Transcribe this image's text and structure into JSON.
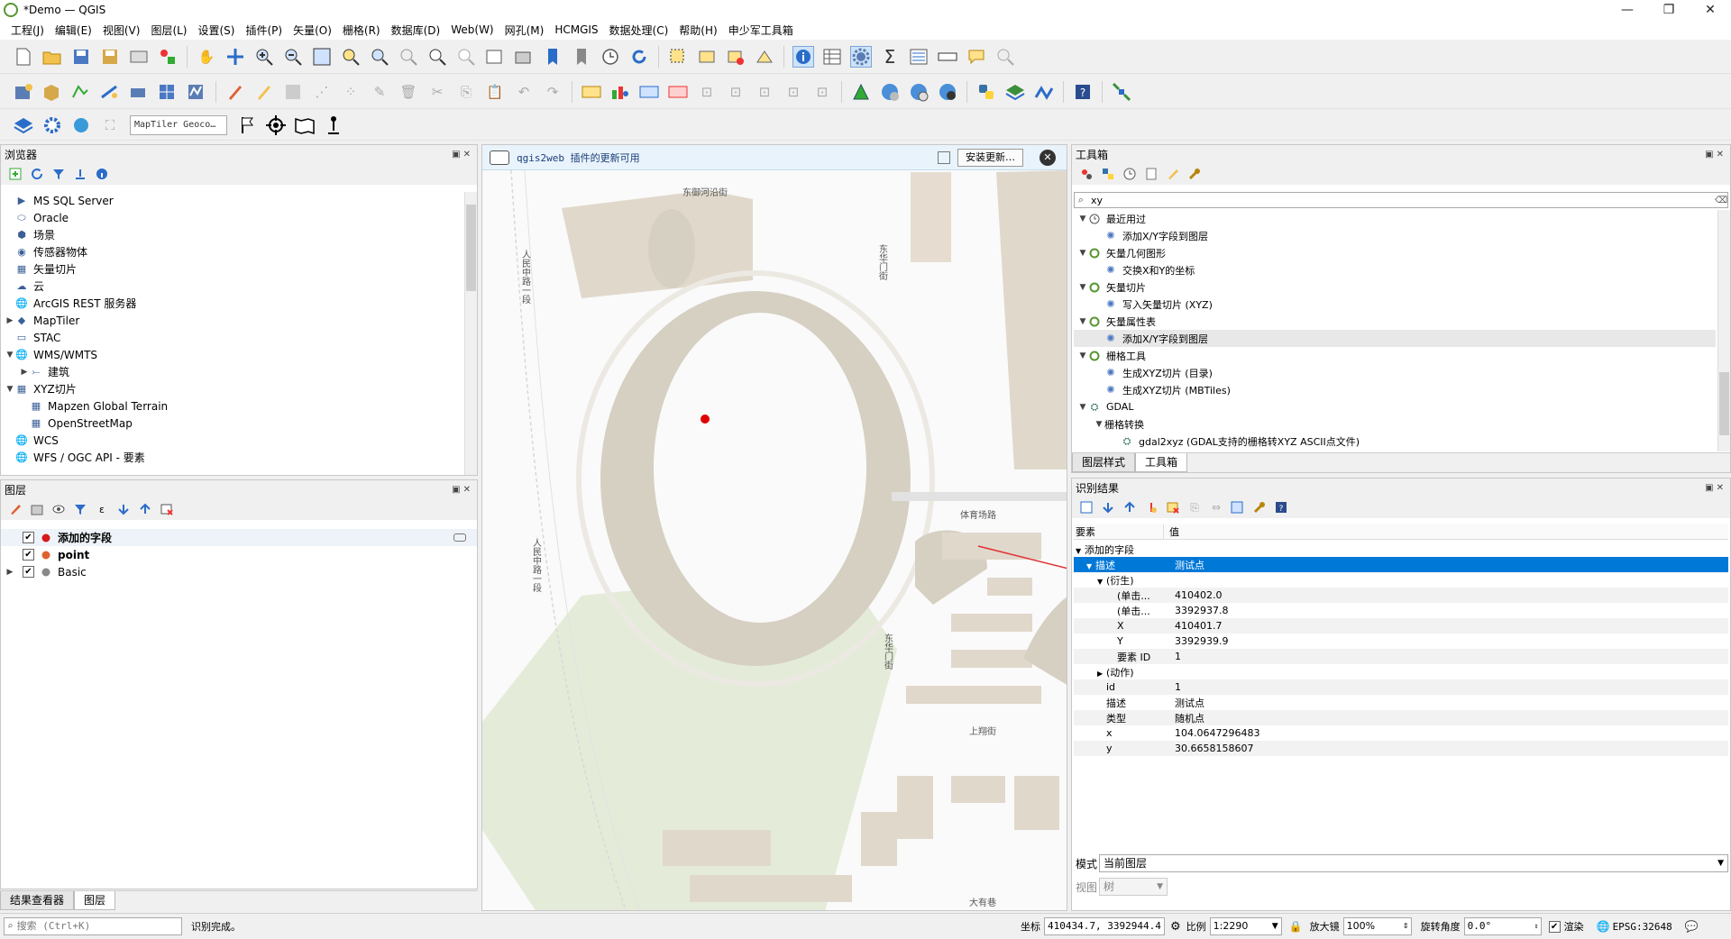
{
  "window": {
    "title": "*Demo — QGIS",
    "minimize": "—",
    "maximize": "❐",
    "close": "✕"
  },
  "menubar": [
    "工程(J)",
    "编辑(E)",
    "视图(V)",
    "图层(L)",
    "设置(S)",
    "插件(P)",
    "矢量(O)",
    "栅格(R)",
    "数据库(D)",
    "Web(W)",
    "网孔(M)",
    "HCMGIS",
    "数据处理(C)",
    "帮助(H)",
    "申少军工具箱"
  ],
  "geocoder": {
    "placeholder": "MapTiler Geoco…"
  },
  "browser": {
    "title": "浏览器",
    "items": [
      {
        "label": "MS SQL Server",
        "icon": "mssql-icon",
        "indent": 0,
        "arrow": ""
      },
      {
        "label": "Oracle",
        "icon": "oracle-icon",
        "indent": 0,
        "arrow": ""
      },
      {
        "label": "场景",
        "icon": "scene-icon",
        "indent": 0,
        "arrow": ""
      },
      {
        "label": "传感器物体",
        "icon": "sensor-icon",
        "indent": 0,
        "arrow": ""
      },
      {
        "label": "矢量切片",
        "icon": "vector-tile-icon",
        "indent": 0,
        "arrow": ""
      },
      {
        "label": "云",
        "icon": "cloud-icon",
        "indent": 0,
        "arrow": ""
      },
      {
        "label": "ArcGIS REST 服务器",
        "icon": "arcgis-icon",
        "indent": 0,
        "arrow": ""
      },
      {
        "label": "MapTiler",
        "icon": "maptiler-icon",
        "indent": 0,
        "arrow": "▶"
      },
      {
        "label": "STAC",
        "icon": "stac-icon",
        "indent": 0,
        "arrow": ""
      },
      {
        "label": "WMS/WMTS",
        "icon": "wms-icon",
        "indent": 0,
        "arrow": "▼"
      },
      {
        "label": "建筑",
        "icon": "wms-layer-icon",
        "indent": 1,
        "arrow": "▶"
      },
      {
        "label": "XYZ切片",
        "icon": "xyz-icon",
        "indent": 0,
        "arrow": "▼"
      },
      {
        "label": "Mapzen Global Terrain",
        "icon": "xyz-layer-icon",
        "indent": 1,
        "arrow": ""
      },
      {
        "label": "OpenStreetMap",
        "icon": "xyz-layer-icon",
        "indent": 1,
        "arrow": ""
      },
      {
        "label": "WCS",
        "icon": "wcs-icon",
        "indent": 0,
        "arrow": ""
      },
      {
        "label": "WFS / OGC API - 要素",
        "icon": "wfs-icon",
        "indent": 0,
        "arrow": ""
      }
    ]
  },
  "layers": {
    "title": "图层",
    "items": [
      {
        "label": "添加的字段",
        "checked": "✔",
        "arrow": "",
        "bold": true,
        "color": "#d7191c"
      },
      {
        "label": "point",
        "checked": "✔",
        "arrow": "",
        "bold": true,
        "color": "#e06030"
      },
      {
        "label": "Basic",
        "checked": "✔",
        "arrow": "▶",
        "bold": false,
        "color": "#888888"
      }
    ]
  },
  "bottomTabs": [
    "结果查看器",
    "图层"
  ],
  "notification": {
    "text": "qgis2web 插件的更新可用",
    "button": "安装更新…"
  },
  "map": {
    "labels": [
      "东御河沿街",
      "人民中路一段",
      "东华门街",
      "体育场路",
      "人民中路一段",
      "东华门街",
      "上翔街",
      "大有巷"
    ]
  },
  "toolbox": {
    "title": "工具箱",
    "search": "xy",
    "items": [
      {
        "label": "最近用过",
        "arrow": "▼",
        "indent": 0,
        "icon": "clock-icon"
      },
      {
        "label": "添加X/Y字段到图层",
        "arrow": "",
        "indent": 1,
        "icon": "gear-icon"
      },
      {
        "label": "矢量几何图形",
        "arrow": "▼",
        "indent": 0,
        "icon": "qgis-icon"
      },
      {
        "label": "交换X和Y的坐标",
        "arrow": "",
        "indent": 1,
        "icon": "gear-icon"
      },
      {
        "label": "矢量切片",
        "arrow": "▼",
        "indent": 0,
        "icon": "qgis-icon"
      },
      {
        "label": "写入矢量切片 (XYZ)",
        "arrow": "",
        "indent": 1,
        "icon": "gear-icon"
      },
      {
        "label": "矢量属性表",
        "arrow": "▼",
        "indent": 0,
        "icon": "qgis-icon"
      },
      {
        "label": "添加X/Y字段到图层",
        "arrow": "",
        "indent": 1,
        "icon": "gear-icon"
      },
      {
        "label": "栅格工具",
        "arrow": "▼",
        "indent": 0,
        "icon": "qgis-icon"
      },
      {
        "label": "生成XYZ切片 (目录)",
        "arrow": "",
        "indent": 1,
        "icon": "gear-icon"
      },
      {
        "label": "生成XYZ切片 (MBTiles)",
        "arrow": "",
        "indent": 1,
        "icon": "gear-icon"
      },
      {
        "label": "GDAL",
        "arrow": "▼",
        "indent": 0,
        "icon": "gdal-icon"
      },
      {
        "label": "栅格转换",
        "arrow": "▼",
        "indent": 1,
        "icon": ""
      },
      {
        "label": "gdal2xyz (GDAL支持的栅格转XYZ ASCII点文件)",
        "arrow": "",
        "indent": 2,
        "icon": "gdal-icon"
      }
    ],
    "tabs": [
      "图层样式",
      "工具箱"
    ]
  },
  "identify": {
    "title": "识别结果",
    "col_feature": "要素",
    "col_value": "值",
    "rows": [
      {
        "k": "添加的字段",
        "v": "",
        "indent": 0,
        "arrow": "▼"
      },
      {
        "k": "描述",
        "v": "测试点",
        "indent": 1,
        "arrow": "▼"
      },
      {
        "k": "(衍生)",
        "v": "",
        "indent": 2,
        "arrow": "▼"
      },
      {
        "k": "(单击...",
        "v": "410402.0",
        "indent": 3,
        "arrow": ""
      },
      {
        "k": "(单击...",
        "v": "3392937.8",
        "indent": 3,
        "arrow": ""
      },
      {
        "k": "X",
        "v": "410401.7",
        "indent": 3,
        "arrow": ""
      },
      {
        "k": "Y",
        "v": "3392939.9",
        "indent": 3,
        "arrow": ""
      },
      {
        "k": "要素 ID",
        "v": "1",
        "indent": 3,
        "arrow": ""
      },
      {
        "k": "(动作)",
        "v": "",
        "indent": 2,
        "arrow": "▶"
      },
      {
        "k": "id",
        "v": "1",
        "indent": 2,
        "arrow": ""
      },
      {
        "k": "描述",
        "v": "测试点",
        "indent": 2,
        "arrow": ""
      },
      {
        "k": "类型",
        "v": "随机点",
        "indent": 2,
        "arrow": ""
      },
      {
        "k": "x",
        "v": "104.0647296483",
        "indent": 2,
        "arrow": ""
      },
      {
        "k": "y",
        "v": "30.6658158607",
        "indent": 2,
        "arrow": ""
      }
    ],
    "mode_label": "模式",
    "mode_value": "当前图层",
    "view_label": "视图",
    "view_value": "树"
  },
  "status": {
    "search_placeholder": "搜索 (Ctrl+K)",
    "message": "识别完成。",
    "coord_label": "坐标",
    "coord_value": "410434.7, 3392944.4",
    "scale_label": "比例",
    "scale_value": "1:2290",
    "magnifier_label": "放大镜",
    "magnifier_value": "100%",
    "rotation_label": "旋转角度",
    "rotation_value": "0.0°",
    "render_label": "渲染",
    "crs": "EPSG:32648"
  }
}
